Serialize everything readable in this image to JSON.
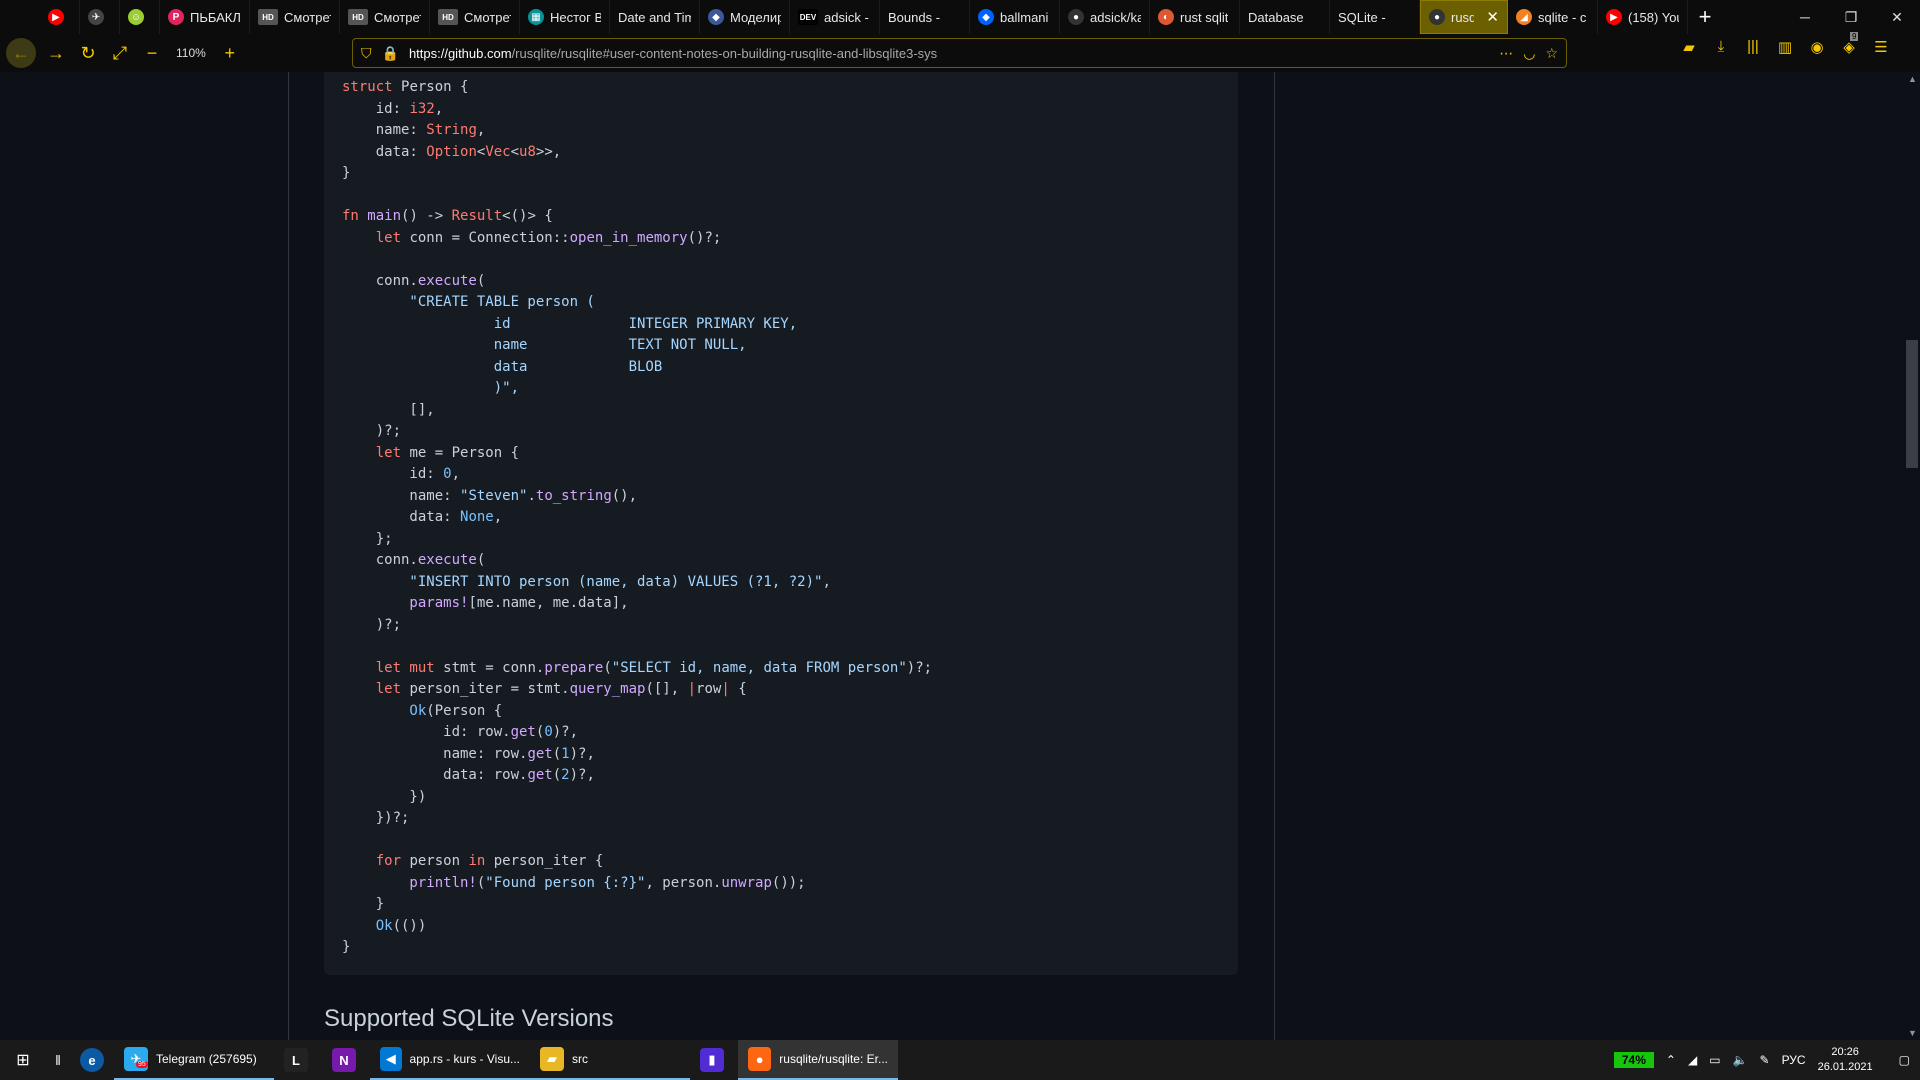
{
  "browser": {
    "tabs": [
      {
        "label": "",
        "color": "#ff0000",
        "glyph": "▶"
      },
      {
        "label": "",
        "color": "#444",
        "glyph": "✈"
      },
      {
        "label": "",
        "color": "#9acd32",
        "glyph": "☺"
      },
      {
        "label": "ПЬБАКЛ",
        "color": "#e0245e",
        "glyph": "P"
      },
      {
        "label": "Смотрет",
        "color": "#555",
        "glyph": "HD"
      },
      {
        "label": "Смотрет",
        "color": "#555",
        "glyph": "HD"
      },
      {
        "label": "Смотрет",
        "color": "#555",
        "glyph": "HD"
      },
      {
        "label": "Нестог В",
        "color": "#0a9396",
        "glyph": "▦"
      },
      {
        "label": "Date and Tim",
        "color": "",
        "glyph": ""
      },
      {
        "label": "Моделир",
        "color": "#3b5998",
        "glyph": "◆"
      },
      {
        "label": "adsick - I",
        "color": "#000",
        "glyph": "DEV"
      },
      {
        "label": "Bounds -",
        "color": "",
        "glyph": ""
      },
      {
        "label": "ballmani",
        "color": "#0061ff",
        "glyph": "◆"
      },
      {
        "label": "adsick/ka",
        "color": "#333",
        "glyph": "●"
      },
      {
        "label": "rust sqlit",
        "color": "#de5833",
        "glyph": "◐"
      },
      {
        "label": "Database",
        "color": "",
        "glyph": ""
      },
      {
        "label": "SQLite -",
        "color": "",
        "glyph": ""
      },
      {
        "label": "rusqli",
        "color": "#333",
        "glyph": "●",
        "active": true
      },
      {
        "label": "sqlite - c",
        "color": "#f48024",
        "glyph": "◢"
      },
      {
        "label": "(158) You",
        "color": "#ff0000",
        "glyph": "▶"
      }
    ],
    "new_tab": "+",
    "minimize": "─",
    "restore": "❐",
    "close": "✕",
    "tab_close": "✕",
    "zoom": "110%",
    "url_host": "https://github.com",
    "url_path": "/rusqlite/rusqlite#user-content-notes-on-building-rusqlite-and-libsqlite3-sys",
    "notification_count": "9"
  },
  "code_lines": [
    [
      [
        "k",
        "struct "
      ],
      [
        "",
        "Person {"
      ]
    ],
    [
      [
        "",
        "    id: "
      ],
      [
        "k",
        "i32"
      ],
      [
        "",
        ","
      ]
    ],
    [
      [
        "",
        "    name: "
      ],
      [
        "k",
        "String"
      ],
      [
        "",
        ","
      ]
    ],
    [
      [
        "",
        "    data: "
      ],
      [
        "k",
        "Option"
      ],
      [
        "",
        "<"
      ],
      [
        "k",
        "Vec"
      ],
      [
        "",
        "<"
      ],
      [
        "k",
        "u8"
      ],
      [
        "",
        ">>,"
      ]
    ],
    [
      [
        "",
        "}"
      ]
    ],
    [
      [
        "",
        ""
      ]
    ],
    [
      [
        "k",
        "fn "
      ],
      [
        "f",
        "main"
      ],
      [
        "",
        "() -> "
      ],
      [
        "k",
        "Result"
      ],
      [
        "",
        "<()> {"
      ]
    ],
    [
      [
        "k",
        "    let "
      ],
      [
        "",
        "conn = Connection::"
      ],
      [
        "f",
        "open_in_memory"
      ],
      [
        "",
        "()?;"
      ]
    ],
    [
      [
        "",
        ""
      ]
    ],
    [
      [
        "",
        "    conn."
      ],
      [
        "f",
        "execute"
      ],
      [
        "",
        "("
      ]
    ],
    [
      [
        "s",
        "        \"CREATE TABLE person ("
      ]
    ],
    [
      [
        "s",
        "                  id              INTEGER PRIMARY KEY,"
      ]
    ],
    [
      [
        "s",
        "                  name            TEXT NOT NULL,"
      ]
    ],
    [
      [
        "s",
        "                  data            BLOB"
      ]
    ],
    [
      [
        "s",
        "                  )\","
      ]
    ],
    [
      [
        "",
        "        [],"
      ]
    ],
    [
      [
        "",
        "    )?;"
      ]
    ],
    [
      [
        "k",
        "    let "
      ],
      [
        "",
        "me = Person {"
      ]
    ],
    [
      [
        "",
        "        id: "
      ],
      [
        "n",
        "0"
      ],
      [
        "",
        ","
      ]
    ],
    [
      [
        "",
        "        name: "
      ],
      [
        "s",
        "\"Steven\""
      ],
      [
        "",
        "."
      ],
      [
        "f",
        "to_string"
      ],
      [
        "",
        "(),"
      ]
    ],
    [
      [
        "",
        "        data: "
      ],
      [
        "n",
        "None"
      ],
      [
        "",
        ","
      ]
    ],
    [
      [
        "",
        "    };"
      ]
    ],
    [
      [
        "",
        "    conn."
      ],
      [
        "f",
        "execute"
      ],
      [
        "",
        "("
      ]
    ],
    [
      [
        "s",
        "        \"INSERT INTO person (name, data) VALUES (?1, ?2)\""
      ],
      [
        "",
        ","
      ]
    ],
    [
      [
        "f",
        "        params!"
      ],
      [
        "",
        "[me.name, me.data],"
      ]
    ],
    [
      [
        "",
        "    )?;"
      ]
    ],
    [
      [
        "",
        ""
      ]
    ],
    [
      [
        "k",
        "    let mut "
      ],
      [
        "",
        "stmt = conn."
      ],
      [
        "f",
        "prepare"
      ],
      [
        "",
        "("
      ],
      [
        "s",
        "\"SELECT id, name, data FROM person\""
      ],
      [
        "",
        ")?;"
      ]
    ],
    [
      [
        "k",
        "    let "
      ],
      [
        "",
        "person_iter = stmt."
      ],
      [
        "f",
        "query_map"
      ],
      [
        "",
        "([], "
      ],
      [
        "k",
        "|"
      ],
      [
        "",
        "row"
      ],
      [
        "k",
        "|"
      ],
      [
        "",
        " {"
      ]
    ],
    [
      [
        "n",
        "        Ok"
      ],
      [
        "",
        "(Person {"
      ]
    ],
    [
      [
        "",
        "            id: row."
      ],
      [
        "f",
        "get"
      ],
      [
        "",
        "("
      ],
      [
        "n",
        "0"
      ],
      [
        "",
        ")?,"
      ]
    ],
    [
      [
        "",
        "            name: row."
      ],
      [
        "f",
        "get"
      ],
      [
        "",
        "("
      ],
      [
        "n",
        "1"
      ],
      [
        "",
        ")?,"
      ]
    ],
    [
      [
        "",
        "            data: row."
      ],
      [
        "f",
        "get"
      ],
      [
        "",
        "("
      ],
      [
        "n",
        "2"
      ],
      [
        "",
        ")?,"
      ]
    ],
    [
      [
        "",
        "        })"
      ]
    ],
    [
      [
        "",
        "    })?;"
      ]
    ],
    [
      [
        "",
        ""
      ]
    ],
    [
      [
        "k",
        "    for "
      ],
      [
        "",
        "person "
      ],
      [
        "k",
        "in "
      ],
      [
        "",
        "person_iter {"
      ]
    ],
    [
      [
        "f",
        "        println!"
      ],
      [
        "",
        "("
      ],
      [
        "s",
        "\"Found person {:?}\""
      ],
      [
        "",
        ", person."
      ],
      [
        "f",
        "unwrap"
      ],
      [
        "",
        "());"
      ]
    ],
    [
      [
        "",
        "    }"
      ]
    ],
    [
      [
        "n",
        "    Ok"
      ],
      [
        "",
        "(())"
      ]
    ],
    [
      [
        "",
        "}"
      ]
    ]
  ],
  "heading": "Supported SQLite Versions",
  "taskbar": {
    "apps": [
      {
        "label": "Telegram (257695)",
        "icon": "✈",
        "color": "#2aabee",
        "wide": true
      },
      {
        "label": "",
        "icon": "L",
        "color": "#222"
      },
      {
        "label": "",
        "icon": "N",
        "color": "#7719aa"
      },
      {
        "label": "app.rs - kurs - Visu...",
        "icon": "◀",
        "color": "#0078d4",
        "wide": true
      },
      {
        "label": "src",
        "icon": "▰",
        "color": "#e8b824",
        "wide": true
      },
      {
        "label": "",
        "icon": "▮",
        "color": "#512bd4"
      },
      {
        "label": "rusqlite/rusqlite: Er...",
        "icon": "●",
        "color": "#ff6611",
        "wide": true,
        "active": true
      }
    ],
    "telegram_badge": "95",
    "battery": "74%",
    "lang": "РУС",
    "time": "20:26",
    "date": "26.01.2021"
  }
}
